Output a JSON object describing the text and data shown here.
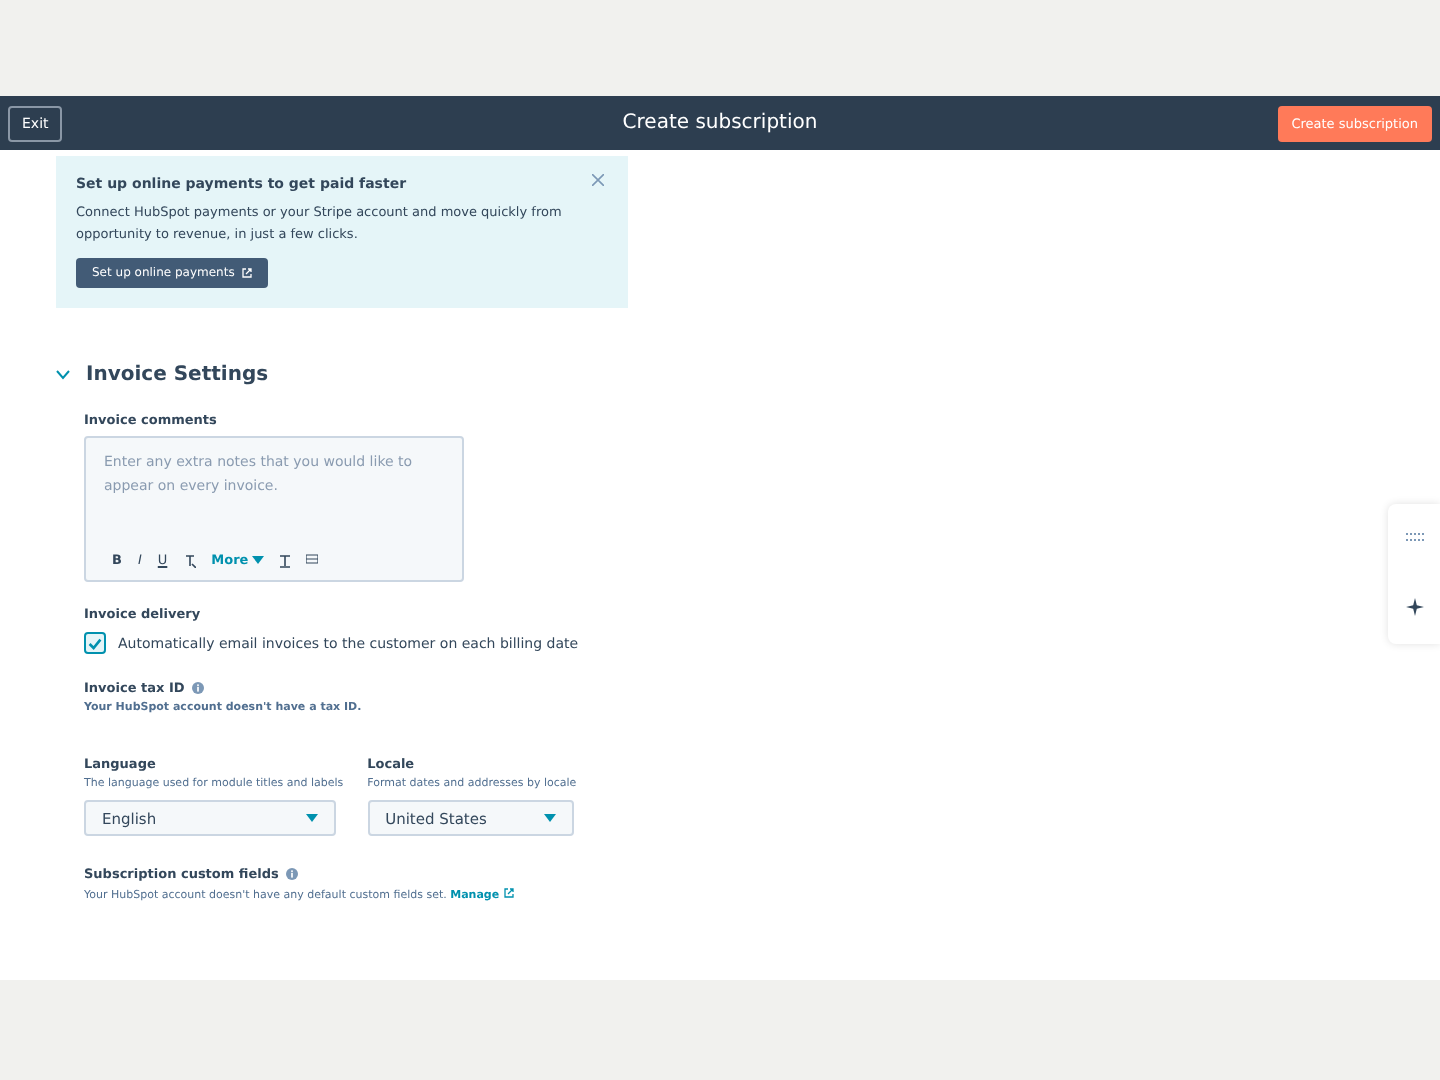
{
  "header": {
    "exit_label": "Exit",
    "title": "Create subscription",
    "primary_button": "Create subscription"
  },
  "banner": {
    "title": "Set up online payments to get paid faster",
    "body": "Connect HubSpot payments or your Stripe account and move quickly from opportunity to revenue, in just a few clicks.",
    "button": "Set up online payments"
  },
  "section": {
    "title": "Invoice Settings",
    "expanded": true
  },
  "invoice_comments": {
    "label": "Invoice comments",
    "placeholder": "Enter any extra notes that you would like to appear on every invoice.",
    "toolbar": [
      "B",
      "I",
      "U"
    ],
    "more": "More"
  },
  "invoice_delivery": {
    "label": "Invoice delivery",
    "option": "Automatically email invoices to the customer on each billing date",
    "checked": true
  },
  "tax_id": {
    "label": "Invoice tax ID",
    "note": "Your HubSpot account doesn't have a tax ID."
  },
  "selects": [
    {
      "label": "Language",
      "help": "The language used for module titles and labels",
      "value": "English"
    },
    {
      "label": "Locale",
      "help": "Format dates and addresses by locale",
      "value": "United States"
    }
  ],
  "custom_fields": {
    "label": "Subscription custom fields",
    "note": "Your HubSpot account doesn't have any default custom fields set.",
    "link": "Manage"
  }
}
